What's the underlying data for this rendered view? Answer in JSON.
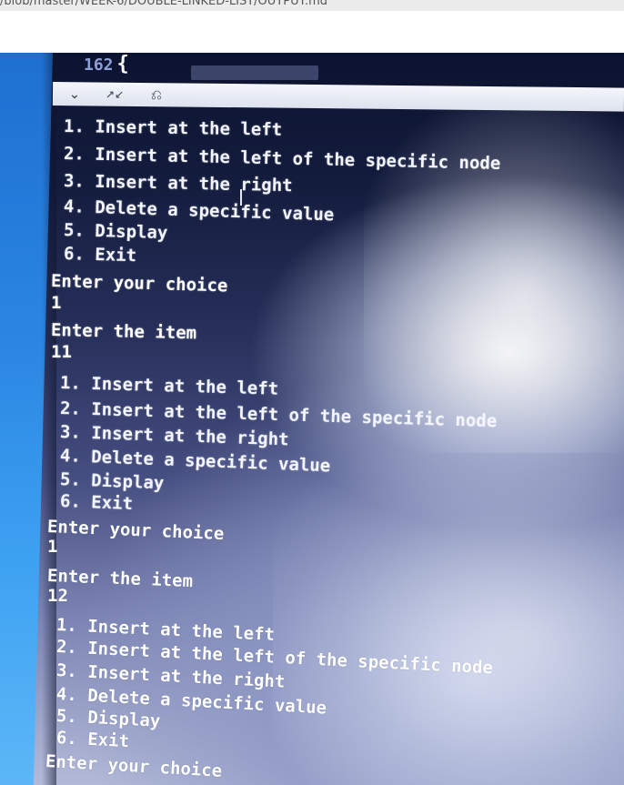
{
  "browser": {
    "url_fragment": "/blob/master/WEEK-6/DOUBLE-LINKED-LIST/OUTPUT.md"
  },
  "editor": {
    "line_number": "162",
    "brace": "{"
  },
  "terminal_toolbar": {
    "icons": [
      "chevron-down-icon",
      "collapse-icon",
      "clear-icon"
    ]
  },
  "terminal_output": {
    "lines": [
      "1. Insert at the left",
      "2. Insert at the left of the specific node",
      "3. Insert at the right",
      "4. Delete a specific value",
      "5. Display",
      "6. Exit",
      "Enter your choice",
      "1",
      "Enter the item",
      "11",
      "1. Insert at the left",
      "2. Insert at the left of the specific node",
      "3. Insert at the right",
      "4. Delete a specific value",
      "5. Display",
      "6. Exit",
      "Enter your choice",
      "1",
      "Enter the item",
      "12",
      "1. Insert at the left",
      "2. Insert at the left of the specific node",
      "3. Insert at the right",
      "4. Delete a specific value",
      "5. Display",
      "6. Exit",
      "Enter your choice"
    ]
  },
  "colors": {
    "screen_bezel_blue": "#2b86e3",
    "terminal_dark": "#0c1330",
    "terminal_light": "#b3bad8",
    "text": "#ffffff"
  }
}
